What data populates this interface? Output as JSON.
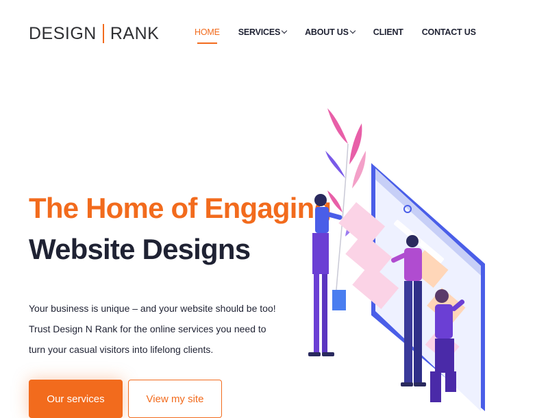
{
  "header": {
    "logo_left": "DESIGN",
    "logo_right": "RANK",
    "nav": [
      {
        "label": "HOME",
        "active": true,
        "has_dropdown": false
      },
      {
        "label": "SERVICES",
        "active": false,
        "has_dropdown": true
      },
      {
        "label": "ABOUT US",
        "active": false,
        "has_dropdown": true
      },
      {
        "label": "CLIENT",
        "active": false,
        "has_dropdown": false
      },
      {
        "label": "CONTACT US",
        "active": false,
        "has_dropdown": false
      }
    ]
  },
  "hero": {
    "headline_line1": "The Home of Engaging",
    "headline_line2": "Website Designs",
    "description": "Your business is unique – and your website should be too! Trust Design N Rank for the online services you need to turn your casual visitors into lifelong clients.",
    "primary_button": "Our services",
    "secondary_button": "View my site"
  },
  "colors": {
    "accent": "#f26b1d",
    "dark": "#1f2233",
    "illustration_blue": "#4a5ee8",
    "illustration_purple": "#6b3fd4",
    "illustration_pink": "#e85fa8"
  },
  "illustration": {
    "icon": "team-building-website-illustration"
  }
}
